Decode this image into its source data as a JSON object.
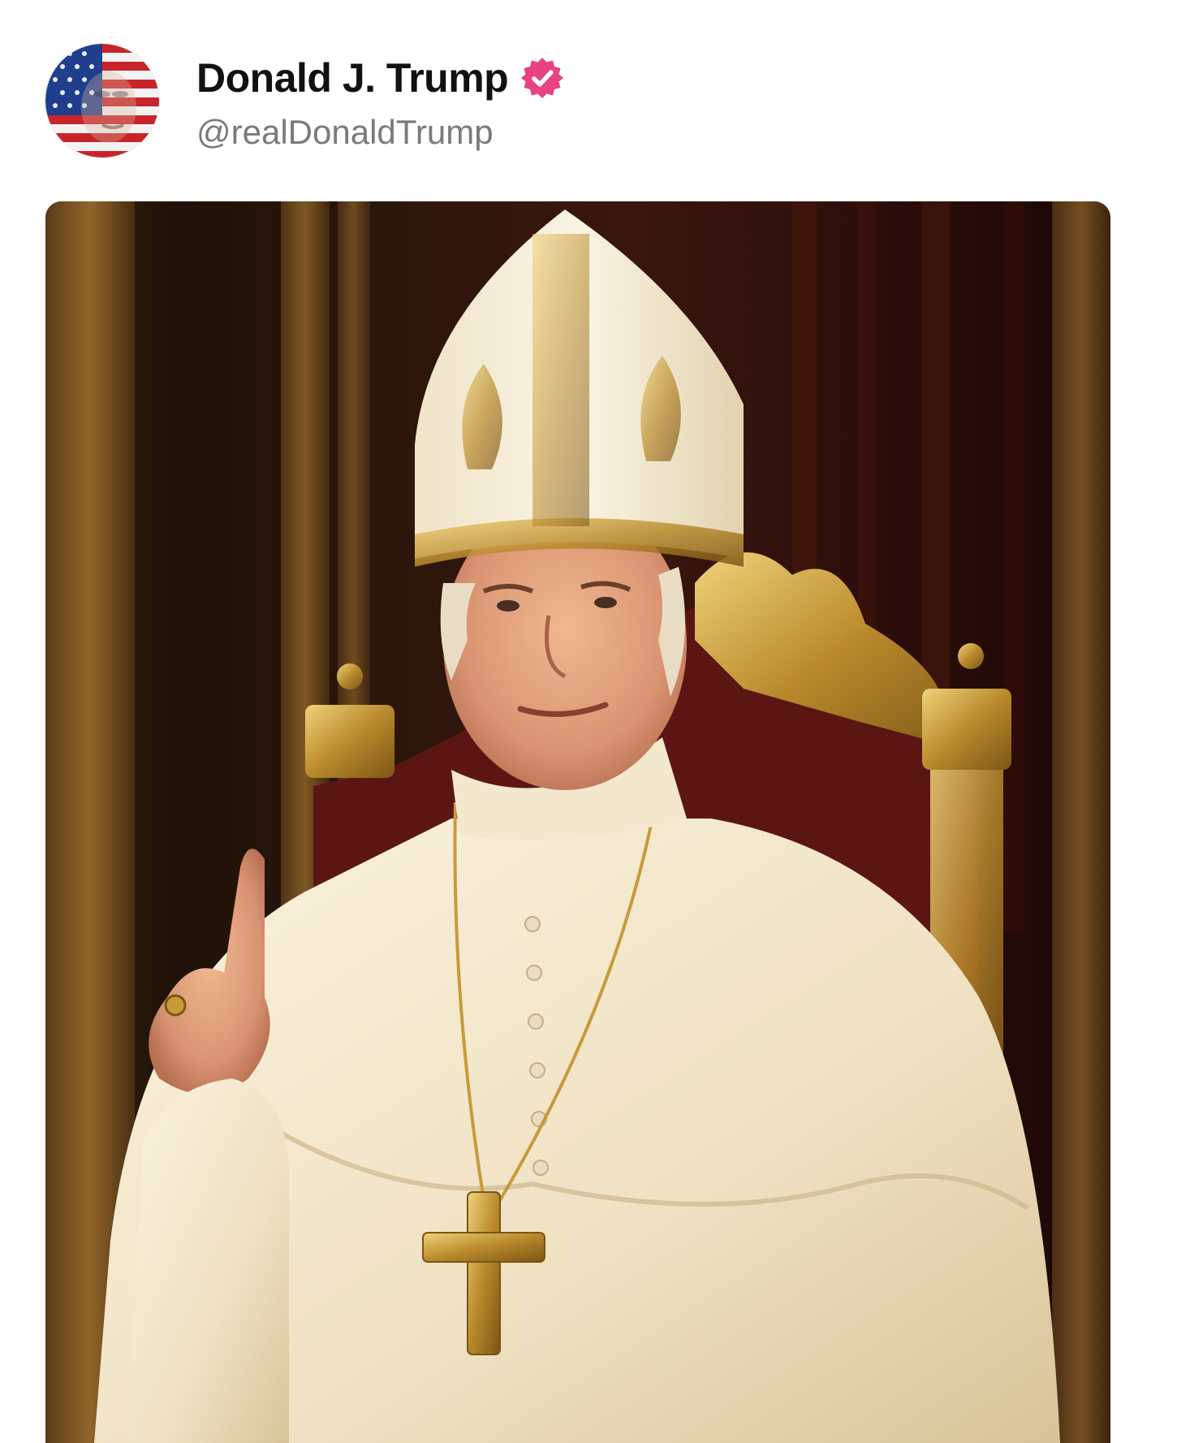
{
  "post": {
    "author": {
      "display_name": "Donald J. Trump",
      "handle": "@realDonaldTrump",
      "verified": true,
      "verified_badge_icon": "verified-badge-icon",
      "verified_color": "#e8427f",
      "avatar_icon": "avatar-flag-portrait"
    },
    "media": {
      "type": "image",
      "subject_icon": "portrait-painting"
    }
  }
}
